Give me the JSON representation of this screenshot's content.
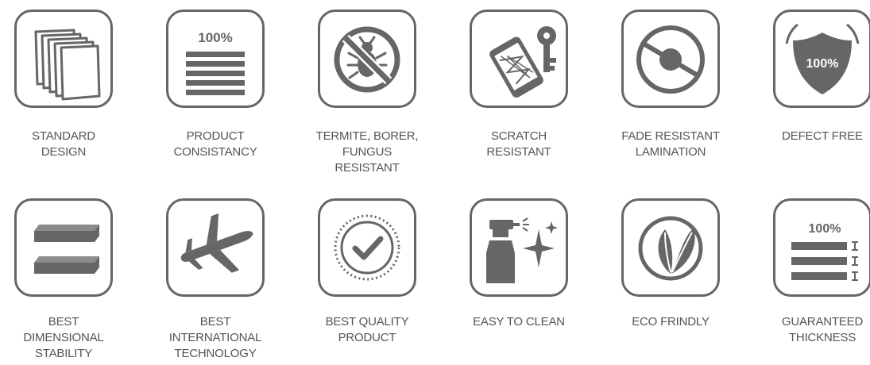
{
  "badges": [
    {
      "caption": "STANDARD\nDESIGN",
      "icon": "stacked-sheets-icon"
    },
    {
      "caption": "PRODUCT\nCONSISTANCY",
      "icon": "consistency-bars-icon",
      "icon_text": "100%"
    },
    {
      "caption": "TERMITE, BORER,\nFUNGUS\nRESISTANT",
      "icon": "no-bug-icon"
    },
    {
      "caption": "SCRATCH\nRESISTANT",
      "icon": "phone-key-scratch-icon"
    },
    {
      "caption": "FADE RESISTANT\nLAMINATION",
      "icon": "no-fade-icon"
    },
    {
      "caption": "DEFECT FREE",
      "icon": "shield-icon",
      "icon_text": "100%"
    },
    {
      "caption": "BEST\nDIMENSIONAL\nSTABILITY",
      "icon": "flat-boards-icon"
    },
    {
      "caption": "BEST\nINTERNATIONAL\nTECHNOLOGY",
      "icon": "airplane-icon"
    },
    {
      "caption": "BEST QUALITY\nPRODUCT",
      "icon": "check-seal-icon"
    },
    {
      "caption": "EASY TO CLEAN",
      "icon": "spray-sparkle-icon"
    },
    {
      "caption": "ECO FRINDLY",
      "icon": "leaf-icon"
    },
    {
      "caption": "GUARANTEED\nTHICKNESS",
      "icon": "thickness-bars-icon",
      "icon_text": "100%"
    }
  ],
  "colors": {
    "icon": "#666666",
    "text": "#555555",
    "background": "#ffffff"
  }
}
